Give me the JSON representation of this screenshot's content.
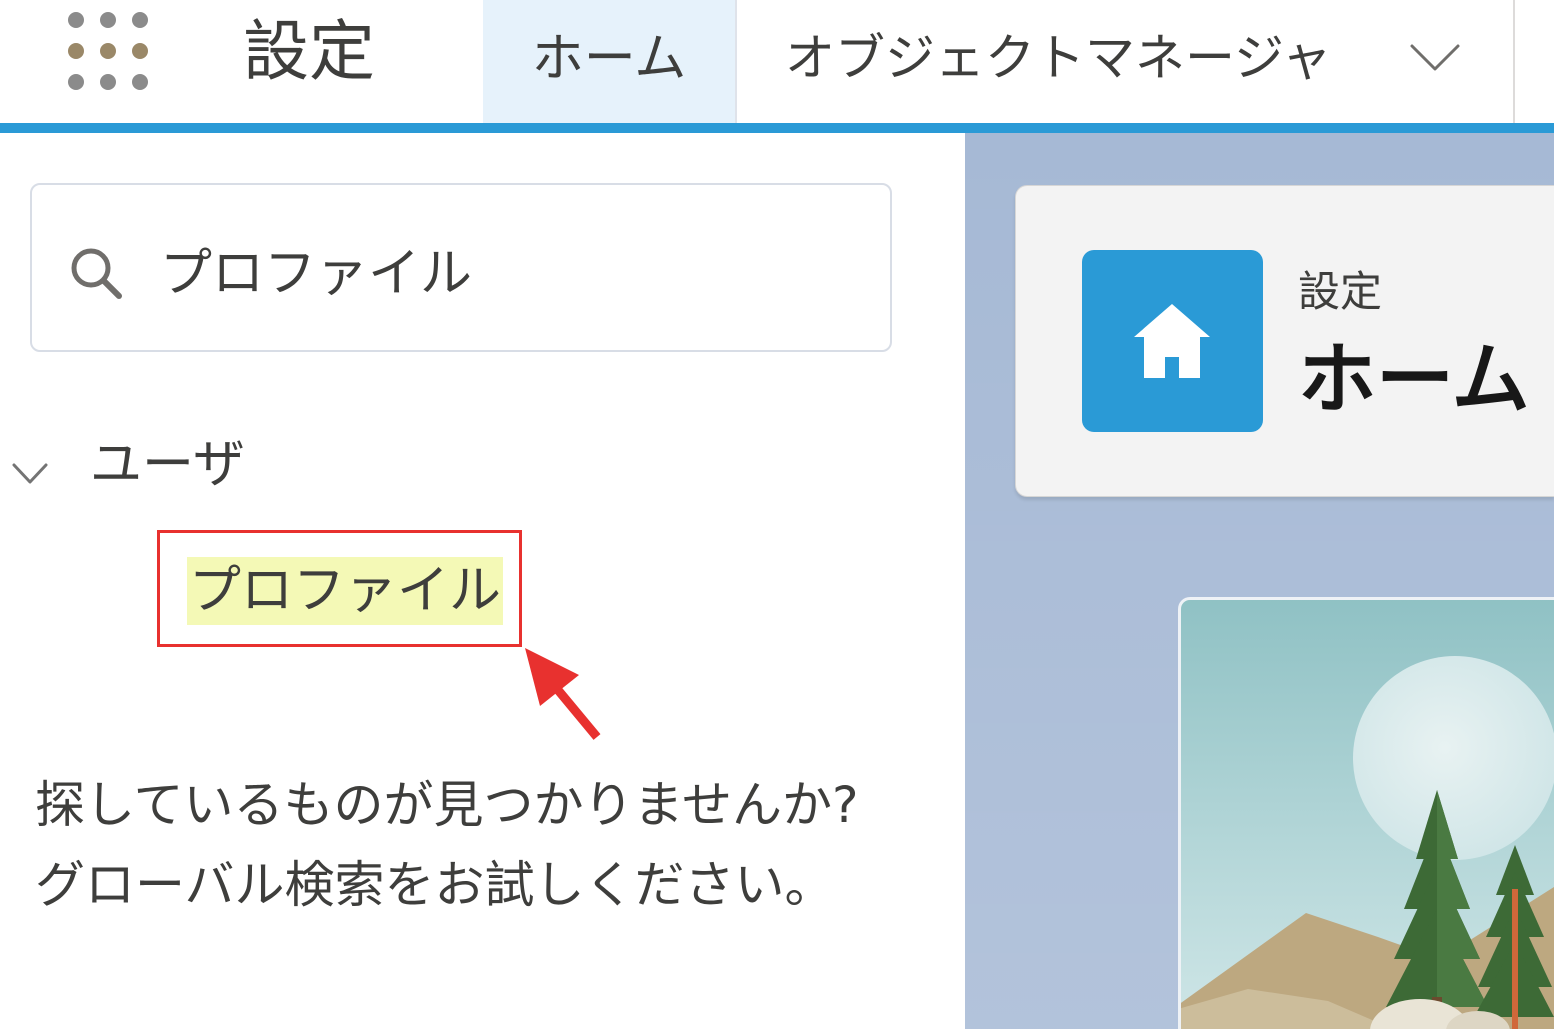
{
  "colors": {
    "brand": "#2a9ad6",
    "selected_tab": "#e6f2fb",
    "highlight": "#f4f9b6",
    "annotation": "#e8312f",
    "workspace": "#a6b9d5"
  },
  "header": {
    "app_launcher_icon": "app-launcher-icon",
    "title": "設定",
    "tabs": [
      {
        "label": "ホーム",
        "selected": true
      },
      {
        "label": "オブジェクトマネージャ",
        "selected": false,
        "menu_icon": "chevron-down-icon"
      }
    ]
  },
  "sidebar": {
    "search": {
      "icon": "search-icon",
      "value": "プロファイル"
    },
    "tree": [
      {
        "label": "ユーザ",
        "expanded": true,
        "toggle_icon": "chevron-down-icon",
        "children": [
          {
            "label": "プロファイル",
            "highlighted": true
          }
        ]
      }
    ],
    "not_found": {
      "line1": "探しているものが見つかりませんか?",
      "line2": "グローバル検索をお試しください。"
    }
  },
  "main": {
    "page_header": {
      "icon": "home-icon",
      "eyebrow": "設定",
      "title": "ホーム"
    }
  }
}
